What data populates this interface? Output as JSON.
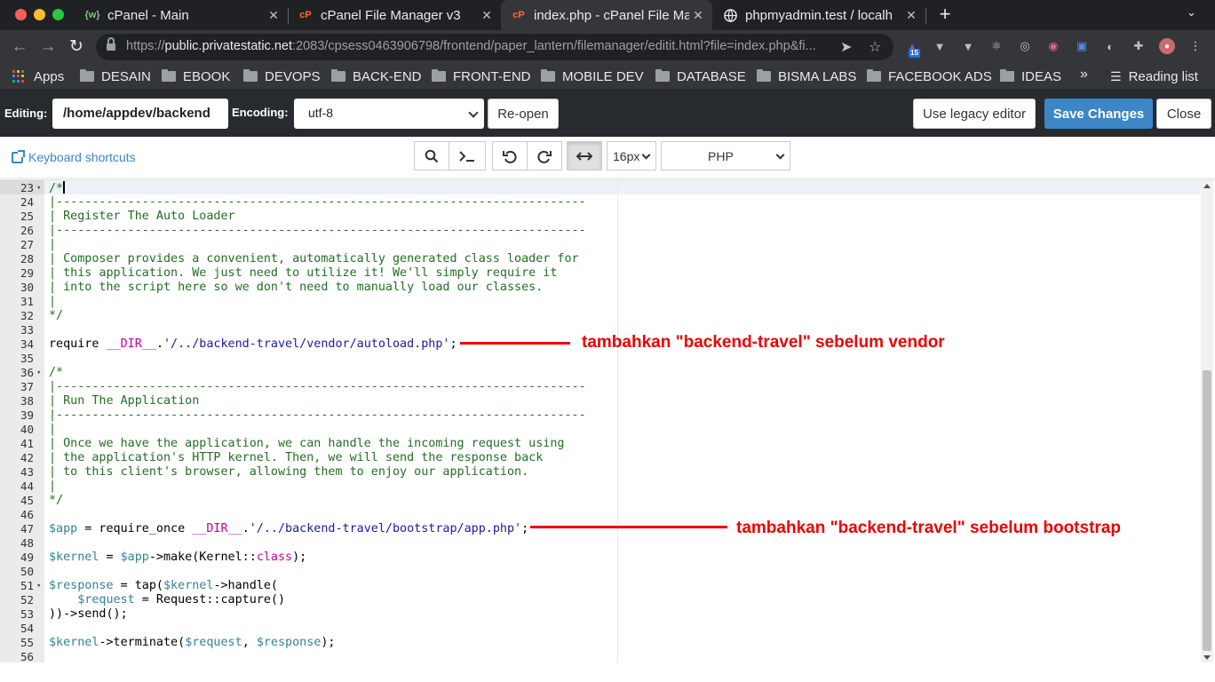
{
  "browser": {
    "tabs": [
      {
        "title": "cPanel - Main",
        "icon": "cpanel-main-icon"
      },
      {
        "title": "cPanel File Manager v3",
        "icon": "cpanel-logo-icon"
      },
      {
        "title": "index.php - cPanel File Ma",
        "icon": "cpanel-logo-icon",
        "active": true
      },
      {
        "title": "phpmyadmin.test / localh",
        "icon": "globe-icon"
      }
    ],
    "url": {
      "scheme": "https://",
      "host": "public.privatestatic.net",
      "rest": ":2083/cpsess0463906798/frontend/paper_lantern/filemanager/editit.html?file=index.php&fi..."
    },
    "extension_badge": "15",
    "bookmarks": [
      "Apps",
      "DESAIN",
      "EBOOK",
      "DEVOPS",
      "BACK-END",
      "FRONT-END",
      "MOBILE DEV",
      "DATABASE",
      "BISMA LABS",
      "FACEBOOK ADS",
      "IDEAS"
    ],
    "bookmarks_more": "»",
    "reading_list": "Reading list"
  },
  "editor_header": {
    "editing_label": "Editing:",
    "path": "/home/appdev/backend",
    "encoding_label": "Encoding:",
    "encoding_value": "utf-8",
    "reopen": "Re-open",
    "legacy": "Use legacy editor",
    "save": "Save Changes",
    "close": "Close"
  },
  "editor_toolbar": {
    "keyboard_shortcuts": "Keyboard shortcuts",
    "font_size": "16px",
    "mode": "PHP"
  },
  "code_lines": [
    {
      "n": "23",
      "fold": true,
      "html": "<span class='c-com'>/*</span><span class='cursor'></span>"
    },
    {
      "n": "24",
      "html": "<span class='c-com'>|--------------------------------------------------------------------------</span>"
    },
    {
      "n": "25",
      "html": "<span class='c-com'>| Register The Auto Loader</span>"
    },
    {
      "n": "26",
      "html": "<span class='c-com'>|--------------------------------------------------------------------------</span>"
    },
    {
      "n": "27",
      "html": "<span class='c-com'>|</span>"
    },
    {
      "n": "28",
      "html": "<span class='c-com'>| Composer provides a convenient, automatically generated class loader for</span>"
    },
    {
      "n": "29",
      "html": "<span class='c-com'>| this application. We just need to utilize it! We'll simply require it</span>"
    },
    {
      "n": "30",
      "html": "<span class='c-com'>| into the script here so we don't need to manually load our classes.</span>"
    },
    {
      "n": "31",
      "html": "<span class='c-com'>|</span>"
    },
    {
      "n": "32",
      "html": "<span class='c-com'>*/</span>"
    },
    {
      "n": "33",
      "html": ""
    },
    {
      "n": "34",
      "html": "require <span class='c-const'>__DIR__</span>.<span class='c-str'>'/../backend-travel/vendor/autoload.php'</span>;"
    },
    {
      "n": "35",
      "html": ""
    },
    {
      "n": "36",
      "fold": true,
      "html": "<span class='c-com'>/*</span>"
    },
    {
      "n": "37",
      "html": "<span class='c-com'>|--------------------------------------------------------------------------</span>"
    },
    {
      "n": "38",
      "html": "<span class='c-com'>| Run The Application</span>"
    },
    {
      "n": "39",
      "html": "<span class='c-com'>|--------------------------------------------------------------------------</span>"
    },
    {
      "n": "40",
      "html": "<span class='c-com'>|</span>"
    },
    {
      "n": "41",
      "html": "<span class='c-com'>| Once we have the application, we can handle the incoming request using</span>"
    },
    {
      "n": "42",
      "html": "<span class='c-com'>| the application's HTTP kernel. Then, we will send the response back</span>"
    },
    {
      "n": "43",
      "html": "<span class='c-com'>| to this client's browser, allowing them to enjoy our application.</span>"
    },
    {
      "n": "44",
      "html": "<span class='c-com'>|</span>"
    },
    {
      "n": "45",
      "html": "<span class='c-com'>*/</span>"
    },
    {
      "n": "46",
      "html": ""
    },
    {
      "n": "47",
      "html": "<span class='c-var'>$app</span> = require_once <span class='c-const'>__DIR__</span>.<span class='c-str'>'/../backend-travel/bootstrap/app.php'</span>;"
    },
    {
      "n": "48",
      "html": ""
    },
    {
      "n": "49",
      "html": "<span class='c-var'>$kernel</span> = <span class='c-var'>$app</span>-&gt;make(Kernel::<span class='c-const'>class</span>);"
    },
    {
      "n": "50",
      "html": ""
    },
    {
      "n": "51",
      "fold": true,
      "html": "<span class='c-var'>$response</span> = tap(<span class='c-var'>$kernel</span>-&gt;handle("
    },
    {
      "n": "52",
      "html": "    <span class='c-var'>$request</span> = Request::capture()"
    },
    {
      "n": "53",
      "html": "))-&gt;send();"
    },
    {
      "n": "54",
      "html": ""
    },
    {
      "n": "55",
      "html": "<span class='c-var'>$kernel</span>-&gt;terminate(<span class='c-var'>$request</span>, <span class='c-var'>$response</span>);"
    },
    {
      "n": "56",
      "html": ""
    }
  ],
  "annotations": {
    "vendor_note": "tambahkan \"backend-travel\" sebelum vendor",
    "bootstrap_note": "tambahkan \"backend-travel\" sebelum bootstrap"
  },
  "colors": {
    "accent": "#3d86c6",
    "annotation": "#ee0000",
    "comment": "#236e24",
    "string": "#1a1aa6"
  }
}
